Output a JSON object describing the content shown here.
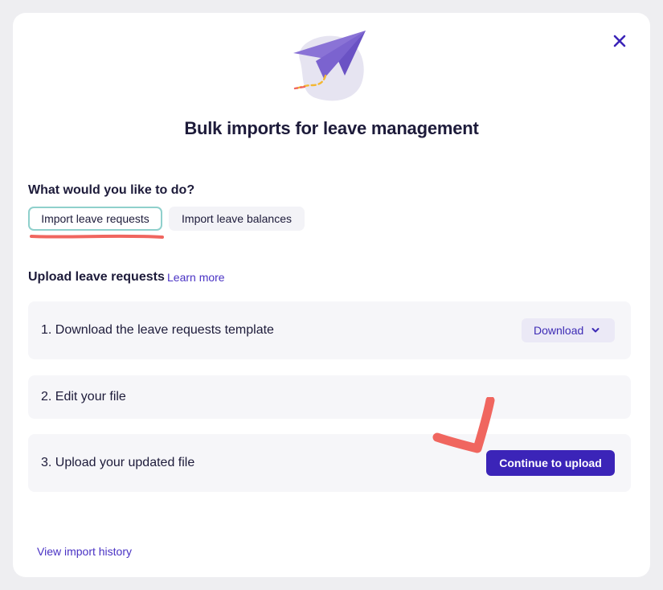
{
  "modal": {
    "title": "Bulk imports for leave management",
    "close_icon": "close-icon",
    "hero_icon": "paper-plane-icon"
  },
  "choice": {
    "question": "What would you like to do?",
    "options": [
      {
        "label": "Import leave requests",
        "selected": true
      },
      {
        "label": "Import leave balances",
        "selected": false
      }
    ]
  },
  "upload": {
    "heading": "Upload leave requests",
    "learn_more": "Learn more",
    "steps": [
      {
        "text": "1. Download the leave requests template",
        "action": "Download"
      },
      {
        "text": "2. Edit your file"
      },
      {
        "text": "3. Upload your updated file",
        "action": "Continue to upload"
      }
    ]
  },
  "footer": {
    "history_link": "View import history"
  },
  "colors": {
    "accent": "#3b24b8",
    "link": "#4932c4",
    "selected_border": "#8fd0cc",
    "annotation": "#f0665f"
  }
}
